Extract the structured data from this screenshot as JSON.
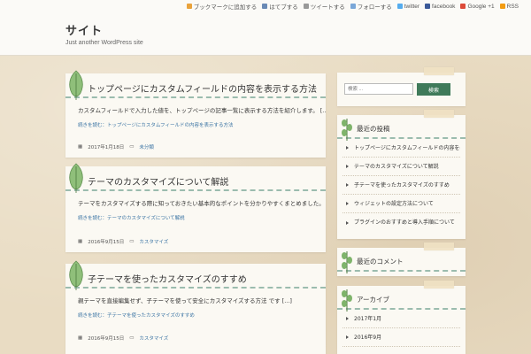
{
  "header": {
    "site_title": "サイト",
    "tagline": "Just another WordPress site",
    "links": [
      {
        "label": "ブックマークに追加する",
        "color": "#e9a23b"
      },
      {
        "label": "はてブする",
        "color": "#6a8ab5"
      },
      {
        "label": "ツイートする",
        "color": "#999999"
      },
      {
        "label": "フォローする",
        "color": "#7aa7d8"
      },
      {
        "label": "twitter",
        "color": "#55acee"
      },
      {
        "label": "facebook",
        "color": "#3b5998"
      },
      {
        "label": "Google +1",
        "color": "#dd4b39"
      },
      {
        "label": "RSS",
        "color": "#f39c12"
      }
    ]
  },
  "posts": [
    {
      "title": "トップページにカスタムフィールドの内容を表示する方法",
      "excerpt": "カスタムフィールドで入力した値を、トップページの記事一覧に表示する方法を紹介します。 [...]",
      "readmore": "続きを読む：トップページにカスタムフィールドの内容を表示する方法",
      "date": "2017年1月18日",
      "category": "未分類"
    },
    {
      "title": "テーマのカスタマイズについて解説",
      "excerpt": "テーマをカスタマイズする際に知っておきたい基本的なポイントを分かりやすくまとめました。 [...]",
      "readmore": "続きを読む：テーマのカスタマイズについて解説",
      "date": "2016年9月15日",
      "category": "カスタマイズ"
    },
    {
      "title": "子テーマを使ったカスタマイズのすすめ",
      "excerpt": "親テーマを直接編集せず、子テーマを使って安全にカスタマイズする方法 です [...]",
      "readmore": "続きを読む：子テーマを使ったカスタマイズのすすめ",
      "date": "2016年9月15日",
      "category": "カスタマイズ"
    }
  ],
  "sidebar": {
    "search": {
      "placeholder": "検索 ...",
      "button": "検索"
    },
    "recent": {
      "title": "最近の投稿",
      "items": [
        "トップページにカスタムフィールドの内容を表示する方法",
        "テーマのカスタマイズについて解説",
        "子テーマを使ったカスタマイズのすすめ",
        "ウィジェットの設定方法について",
        "プラグインのおすすめと導入手順について"
      ]
    },
    "comments": {
      "title": "最近のコメント"
    },
    "archives": {
      "title": "アーカイブ",
      "items": [
        "2017年1月",
        "2016年9月"
      ]
    }
  }
}
